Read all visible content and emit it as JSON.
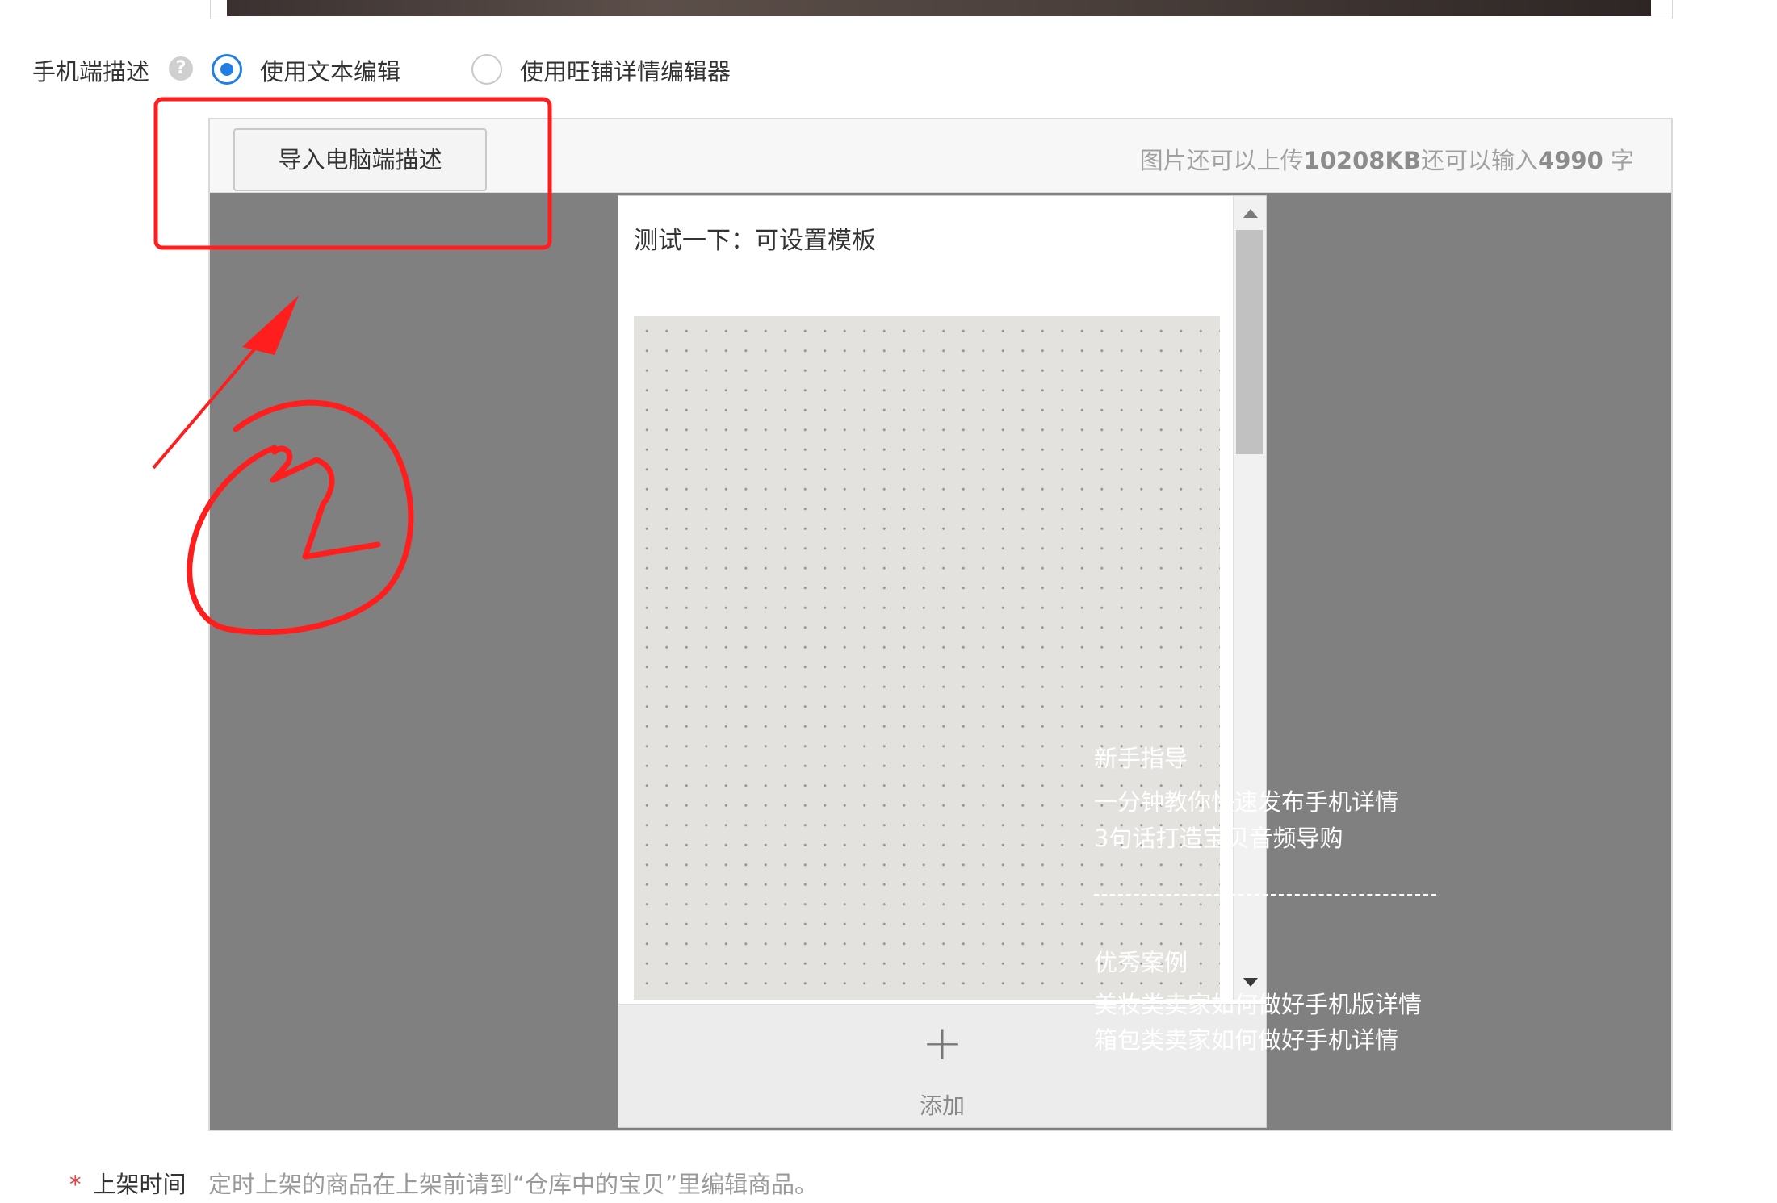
{
  "mobile_desc": {
    "label": "手机端描述",
    "help_icon": "?",
    "options": [
      {
        "label": "使用文本编辑",
        "checked": true
      },
      {
        "label": "使用旺铺详情编辑器",
        "checked": false
      }
    ]
  },
  "editor": {
    "import_button": "导入电脑端描述",
    "quota_prefix": "图片还可以上传",
    "quota_image": "10208KB",
    "quota_mid": "还可以输入",
    "quota_chars": "4990",
    "quota_suffix": " 字",
    "preview_title": "测试一下：可设置模板",
    "add_label": "添加",
    "add_icon": "+"
  },
  "guide": {
    "heading": "新手指导",
    "links": [
      "一分钟教你快速发布手机详情",
      "3句话打造宝贝音频导购"
    ],
    "cases_heading": "优秀案例",
    "cases": [
      "美妆类卖家如何做好手机版详情",
      "箱包类卖家如何做好手机详情"
    ]
  },
  "release": {
    "star": "*",
    "label": "上架时间",
    "hint": "定时上架的商品在上架前请到“仓库中的宝贝”里编辑商品。"
  },
  "annotation": {
    "color": "#ff1e1e",
    "number_icon": "circled-2-icon"
  }
}
